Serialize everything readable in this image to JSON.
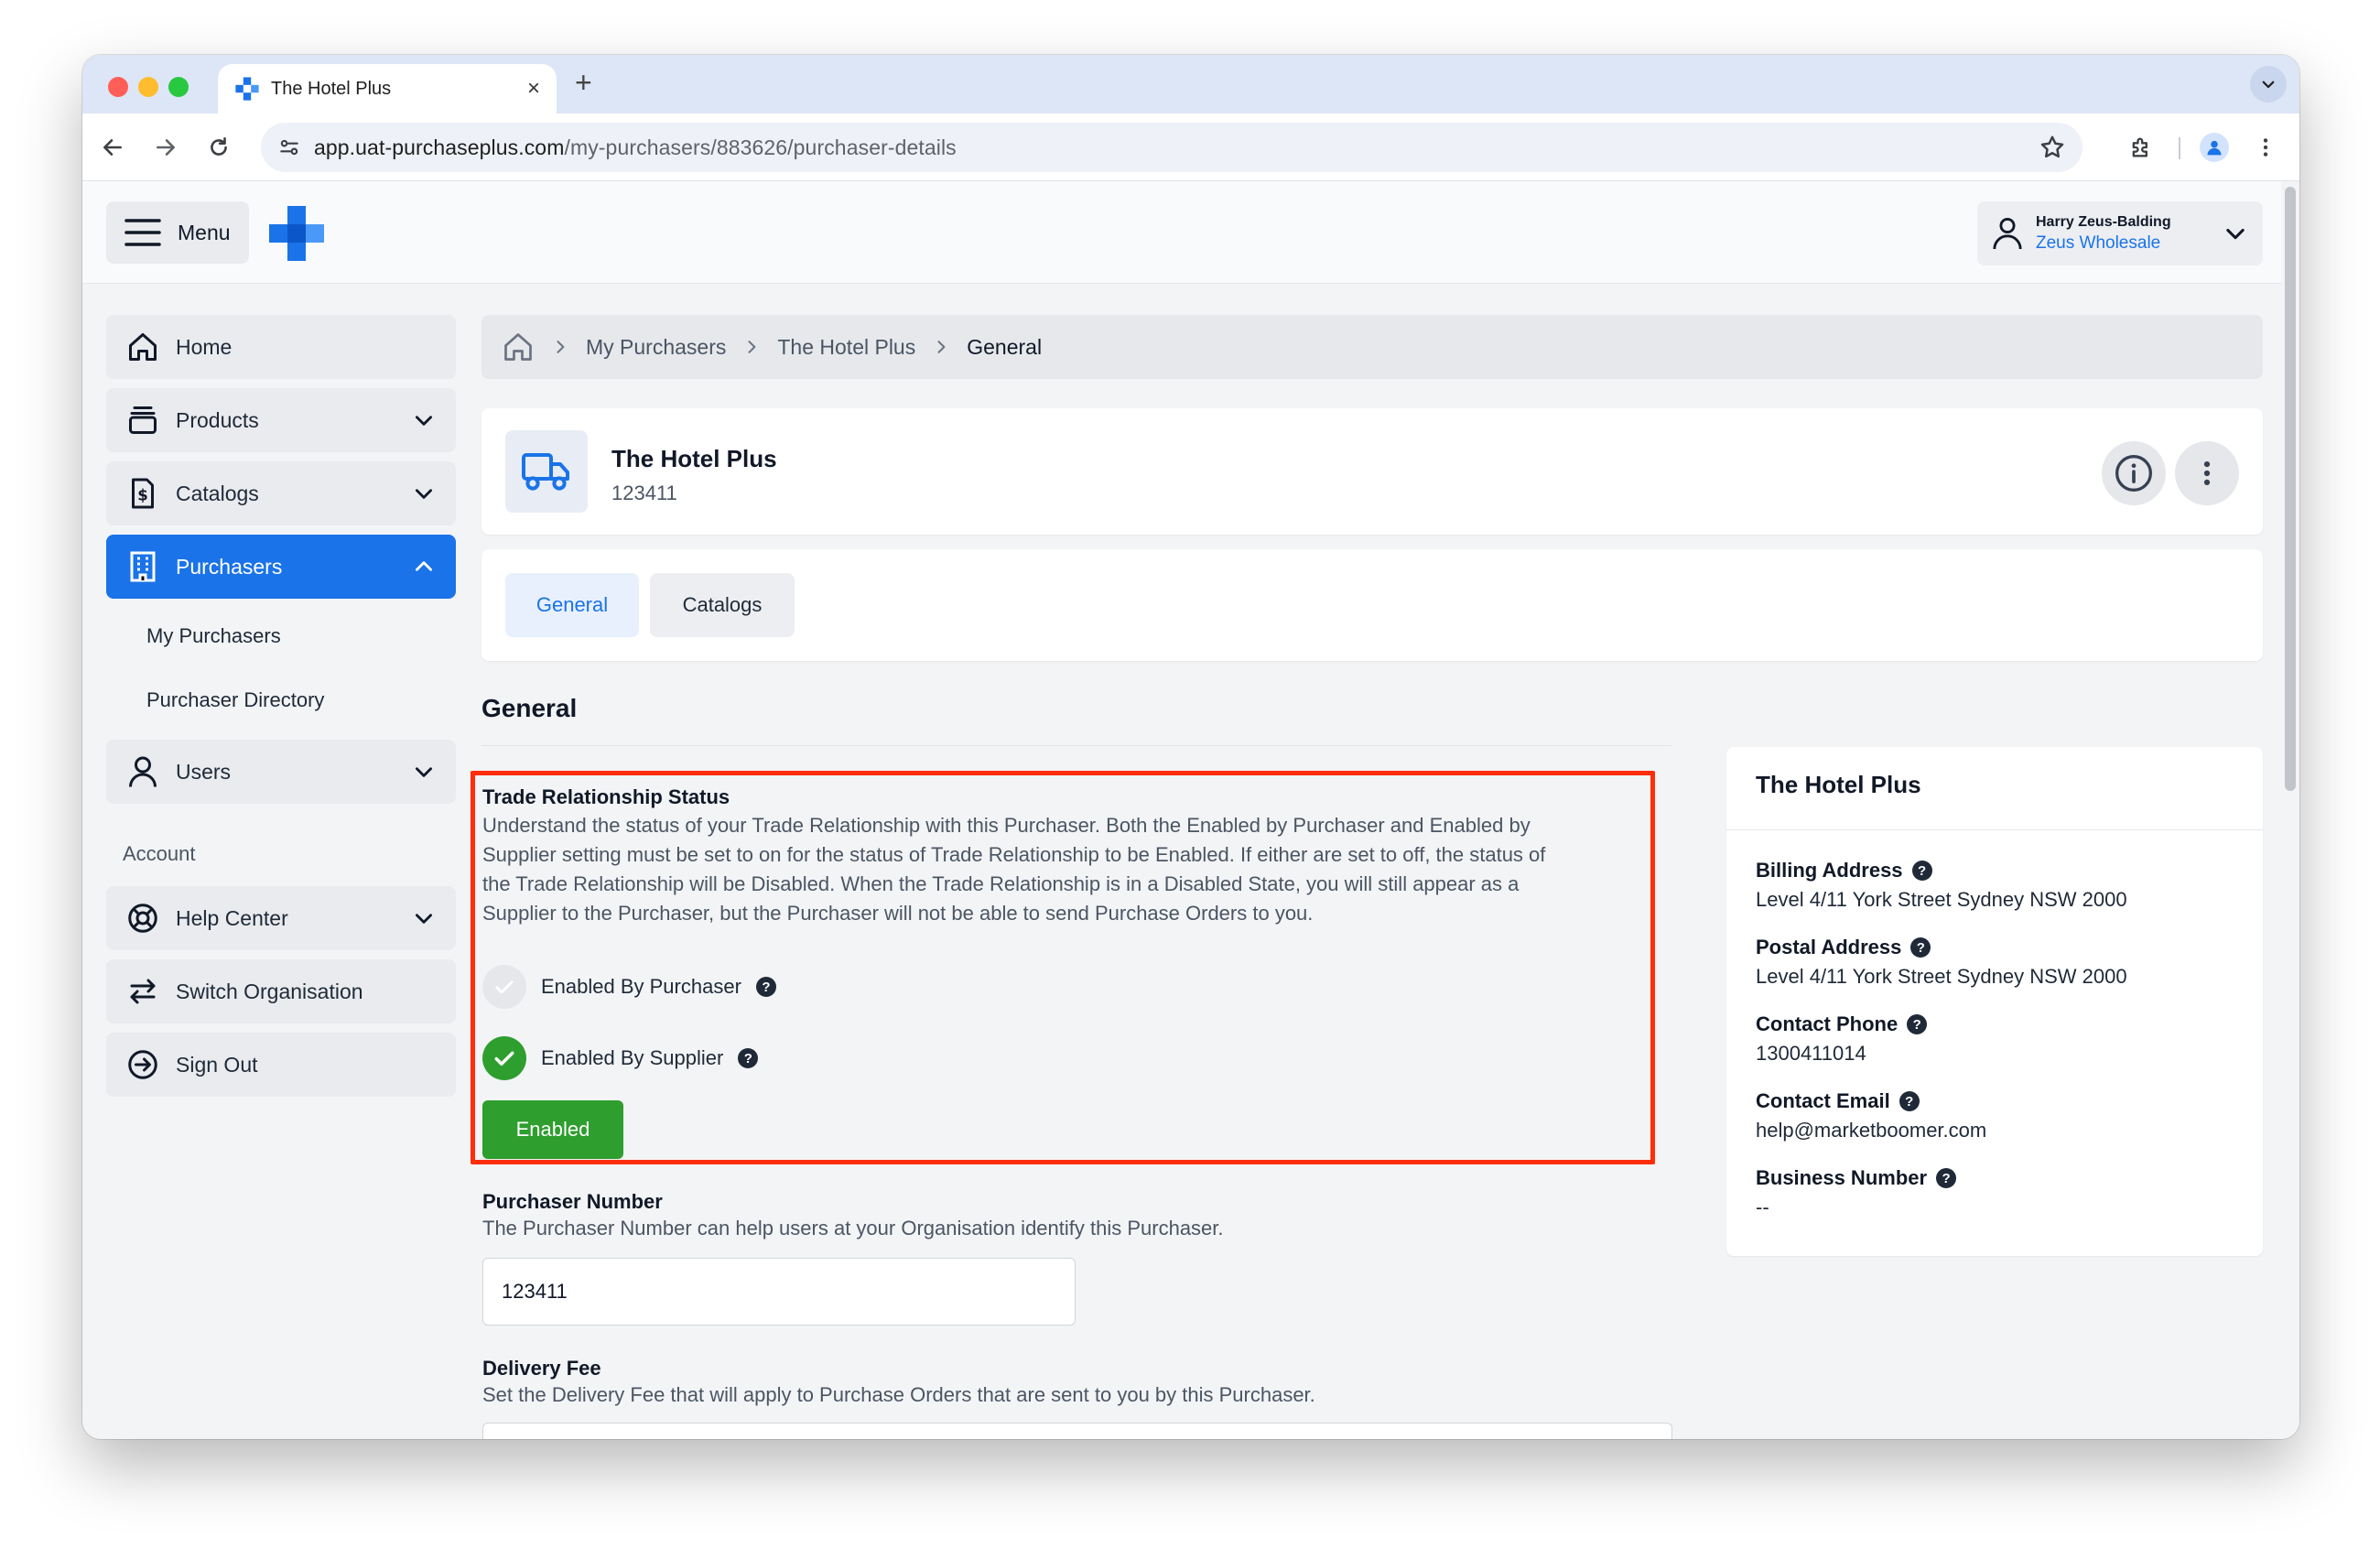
{
  "browser": {
    "tab_title": "The Hotel Plus",
    "tab_close": "×",
    "new_tab": "+",
    "url_host": "app.uat-purchaseplus.com",
    "url_path": "/my-purchasers/883626/purchaser-details"
  },
  "header": {
    "menu_label": "Menu",
    "user_name": "Harry Zeus-Balding",
    "user_org": "Zeus Wholesale"
  },
  "sidebar": {
    "items": [
      {
        "label": "Home",
        "icon": "home-icon"
      },
      {
        "label": "Products",
        "icon": "products-icon"
      },
      {
        "label": "Catalogs",
        "icon": "catalogs-icon"
      },
      {
        "label": "Purchasers",
        "icon": "purchasers-icon"
      },
      {
        "label": "Users",
        "icon": "users-icon"
      }
    ],
    "purchaser_sub": [
      "My Purchasers",
      "Purchaser Directory"
    ],
    "account_heading": "Account",
    "account_items": [
      {
        "label": "Help Center",
        "icon": "help-center-icon"
      },
      {
        "label": "Switch Organisation",
        "icon": "switch-icon"
      },
      {
        "label": "Sign Out",
        "icon": "sign-out-icon"
      }
    ]
  },
  "breadcrumb": [
    "My Purchasers",
    "The Hotel Plus",
    "General"
  ],
  "purchaser": {
    "name": "The Hotel Plus",
    "number": "123411"
  },
  "tabs": [
    "General",
    "Catalogs"
  ],
  "general": {
    "title": "General",
    "trade_label": "Trade Relationship Status",
    "trade_desc": [
      "Understand the status of your Trade Relationship with this Purchaser. Both the Enabled by Purchaser and Enabled by",
      "Supplier setting must be set to on for the status of Trade Relationship to be Enabled. If either are set to off, the status of",
      "the Trade Relationship will be Disabled. When the Trade Relationship is in a Disabled State, you will still appear as a",
      "Supplier to the Purchaser, but the Purchaser will not be able to send Purchase Orders to you."
    ],
    "enabled_by_purchaser": "Enabled By Purchaser",
    "enabled_by_supplier": "Enabled By Supplier",
    "status": "Enabled",
    "purchaser_number_label": "Purchaser Number",
    "purchaser_number_desc": "The Purchaser Number can help users at your Organisation identify this Purchaser.",
    "purchaser_number_value": "123411",
    "delivery_fee_label": "Delivery Fee",
    "delivery_fee_desc": "Set the Delivery Fee that will apply to Purchase Orders that are sent to you by this Purchaser.",
    "help_glyph": "?"
  },
  "side_card": {
    "title": "The Hotel Plus",
    "fields": [
      {
        "label": "Billing Address",
        "value": "Level 4/11 York Street Sydney NSW 2000"
      },
      {
        "label": "Postal Address",
        "value": "Level 4/11 York Street Sydney NSW 2000"
      },
      {
        "label": "Contact Phone",
        "value": "1300411014"
      },
      {
        "label": "Contact Email",
        "value": "help@marketboomer.com"
      },
      {
        "label": "Business Number",
        "value": "--"
      }
    ]
  },
  "colors": {
    "brand": "#1a73e8",
    "success": "#2e9e2e",
    "highlight": "#ff2d0a"
  }
}
